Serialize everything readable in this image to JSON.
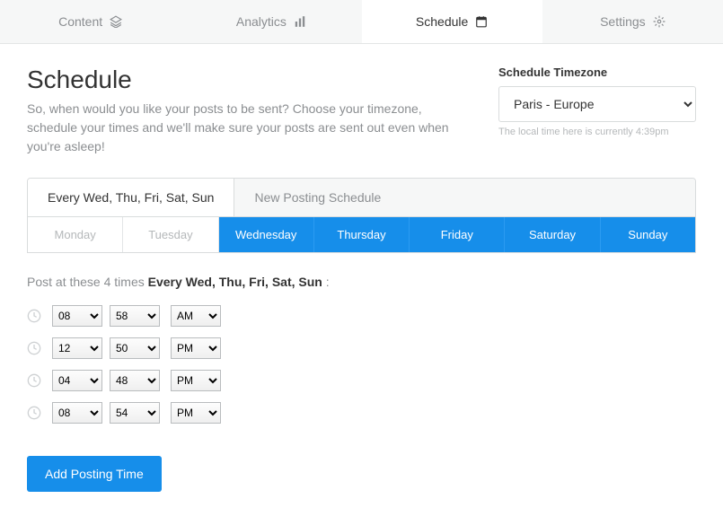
{
  "nav": {
    "tabs": [
      {
        "label": "Content",
        "icon": "layers-icon"
      },
      {
        "label": "Analytics",
        "icon": "bars-icon"
      },
      {
        "label": "Schedule",
        "icon": "calendar-icon"
      },
      {
        "label": "Settings",
        "icon": "gear-icon"
      }
    ],
    "activeIndex": 2
  },
  "page": {
    "title": "Schedule",
    "subtitle": "So, when would you like your posts to be sent? Choose your timezone, schedule your times and we'll make sure your posts are sent out even when you're asleep!"
  },
  "timezone": {
    "label": "Schedule Timezone",
    "value": "Paris - Europe",
    "note": "The local time here is currently 4:39pm"
  },
  "scheduleTabs": {
    "items": [
      {
        "label": "Every Wed, Thu, Fri, Sat, Sun"
      },
      {
        "label": "New Posting Schedule"
      }
    ],
    "activeIndex": 0
  },
  "days": [
    {
      "label": "Monday",
      "selected": false
    },
    {
      "label": "Tuesday",
      "selected": false
    },
    {
      "label": "Wednesday",
      "selected": true
    },
    {
      "label": "Thursday",
      "selected": true
    },
    {
      "label": "Friday",
      "selected": true
    },
    {
      "label": "Saturday",
      "selected": true
    },
    {
      "label": "Sunday",
      "selected": true
    }
  ],
  "postTimes": {
    "prefix": "Post at these 4 times ",
    "bold": "Every Wed, Thu, Fri, Sat, Sun",
    "suffix": " :",
    "times": [
      {
        "hour": "08",
        "minute": "58",
        "ampm": "AM"
      },
      {
        "hour": "12",
        "minute": "50",
        "ampm": "PM"
      },
      {
        "hour": "04",
        "minute": "48",
        "ampm": "PM"
      },
      {
        "hour": "08",
        "minute": "54",
        "ampm": "PM"
      }
    ]
  },
  "addButton": "Add Posting Time"
}
